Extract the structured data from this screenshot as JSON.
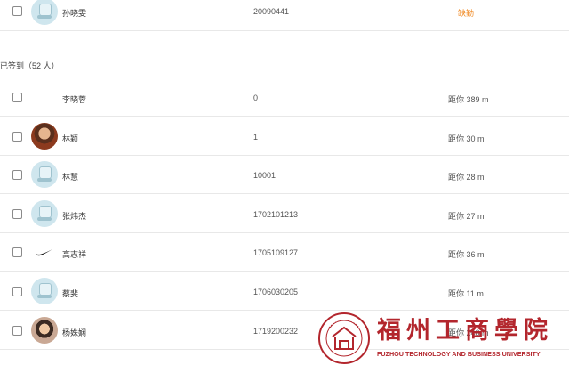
{
  "top_row": {
    "name": "孙晓雯",
    "student_id": "20090441",
    "status": "缺勤"
  },
  "checked_in": {
    "title": "已签到（52 人）",
    "rows": [
      {
        "name": "李晓蓉",
        "student_id": "0",
        "distance": "距你 389 m",
        "avatar": "none"
      },
      {
        "name": "林颖",
        "student_id": "1",
        "distance": "距你 30 m",
        "avatar": "photo1"
      },
      {
        "name": "林慧",
        "student_id": "10001",
        "distance": "距你 28 m",
        "avatar": "default"
      },
      {
        "name": "张炜杰",
        "student_id": "1702101213",
        "distance": "距你 27 m",
        "avatar": "default"
      },
      {
        "name": "高志祥",
        "student_id": "1705109127",
        "distance": "距你 36 m",
        "avatar": "nike"
      },
      {
        "name": "蔡斐",
        "student_id": "1706030205",
        "distance": "距你 11 m",
        "avatar": "default"
      },
      {
        "name": "杨姝娴",
        "student_id": "1719200232",
        "distance": "距你 240 m",
        "avatar": "photo2"
      }
    ]
  },
  "watermark": {
    "name_cn": "福州工商學院",
    "name_en": "FUZHOU TECHNOLOGY AND BUSINESS UNIVERSITY",
    "brand_color": "#b3262d"
  }
}
